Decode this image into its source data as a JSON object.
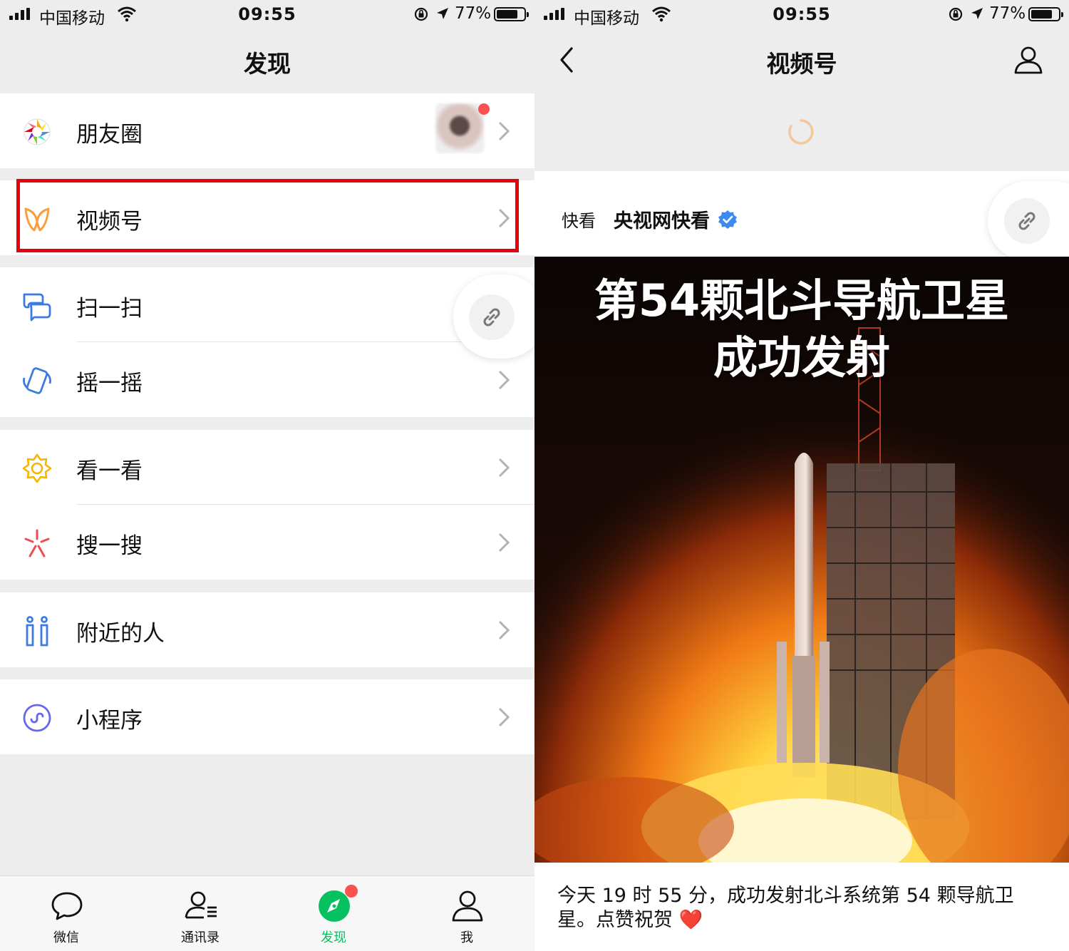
{
  "status": {
    "carrier": "中国移动",
    "time": "09:55",
    "battery_pct": "77%",
    "battery_level": 0.77
  },
  "left": {
    "nav_title": "发现",
    "groups": [
      {
        "items": [
          {
            "label": "朋友圈",
            "icon": "moments-icon"
          }
        ]
      },
      {
        "items": [
          {
            "label": "视频号",
            "icon": "channels-icon"
          }
        ]
      },
      {
        "items": [
          {
            "label": "扫一扫",
            "icon": "scan-icon"
          },
          {
            "label": "摇一摇",
            "icon": "shake-icon"
          }
        ]
      },
      {
        "items": [
          {
            "label": "看一看",
            "icon": "top-stories-icon"
          },
          {
            "label": "搜一搜",
            "icon": "search-icon"
          }
        ]
      },
      {
        "items": [
          {
            "label": "附近的人",
            "icon": "people-nearby-icon"
          }
        ]
      },
      {
        "items": [
          {
            "label": "小程序",
            "icon": "mini-programs-icon"
          }
        ]
      }
    ],
    "tabs": [
      {
        "label": "微信",
        "icon": "chat-bubble-icon",
        "active": false
      },
      {
        "label": "通讯录",
        "icon": "contacts-icon",
        "active": false
      },
      {
        "label": "发现",
        "icon": "compass-icon",
        "active": true
      },
      {
        "label": "我",
        "icon": "person-icon",
        "active": false
      }
    ],
    "colors": {
      "active_tab": "#07c160",
      "highlight_box": "#e5020b",
      "badge": "#fa5151"
    }
  },
  "right": {
    "nav_title": "视频号",
    "author": {
      "logo_text": "快看",
      "name": "央视网快看"
    },
    "video": {
      "title_line1": "第54颗北斗导航卫星",
      "title_line2": "成功发射"
    },
    "caption": "今天 19 时 55 分，成功发射北斗系统第 54 颗导航卫星。点赞祝贺",
    "caption_emoji": "❤️"
  }
}
